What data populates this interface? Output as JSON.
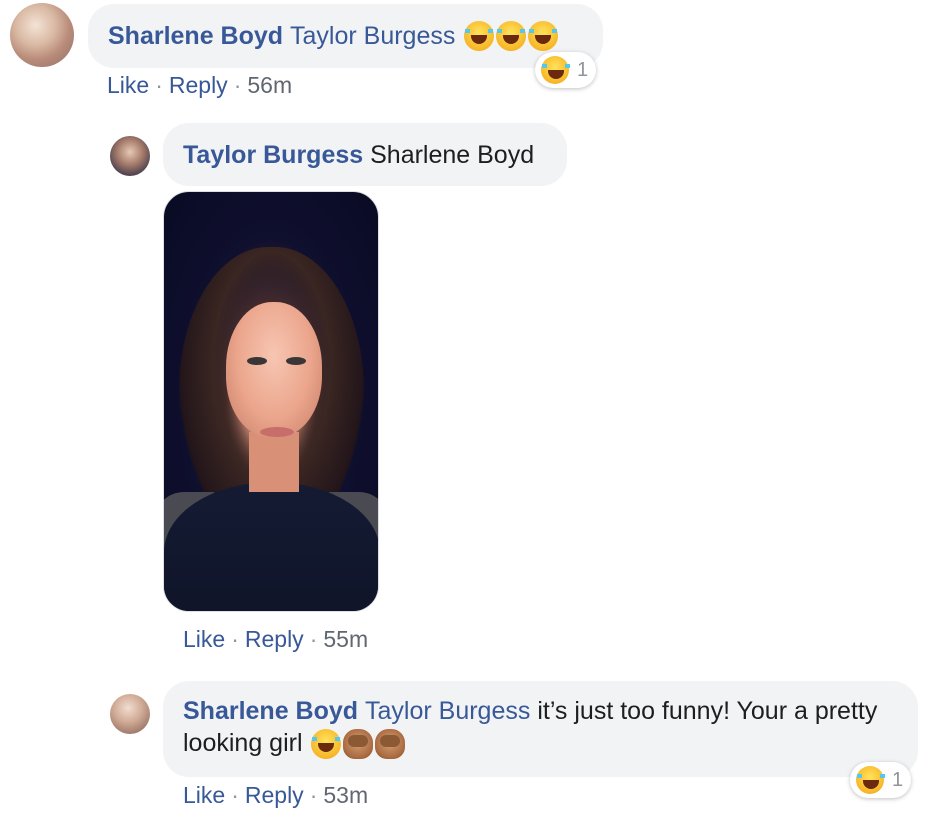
{
  "comments": [
    {
      "author": "Sharlene Boyd",
      "mention": "Taylor Burgess",
      "text": "",
      "emojis": [
        "face-with-tears-of-joy",
        "face-with-tears-of-joy",
        "face-with-tears-of-joy"
      ],
      "actions": {
        "like": "Like",
        "reply": "Reply",
        "time": "56m"
      },
      "reaction": {
        "icon": "laughing-face",
        "count": "1"
      }
    },
    {
      "author": "Taylor Burgess",
      "mention": "Sharlene Boyd",
      "text": "",
      "photo": "selfie-photo",
      "actions": {
        "like": "Like",
        "reply": "Reply",
        "time": "55m"
      }
    },
    {
      "author": "Sharlene Boyd",
      "mention": "Taylor Burgess",
      "text": "it’s just too funny! Your a pretty looking girl",
      "emojis": [
        "face-with-tears-of-joy",
        "see-no-evil-monkey",
        "see-no-evil-monkey"
      ],
      "actions": {
        "like": "Like",
        "reply": "Reply",
        "time": "53m"
      },
      "reaction": {
        "icon": "laughing-face",
        "count": "1"
      }
    }
  ],
  "separator": "·"
}
